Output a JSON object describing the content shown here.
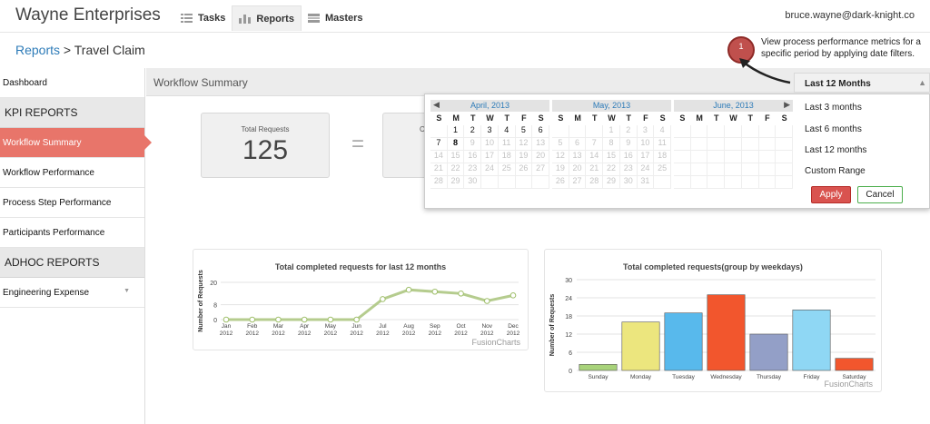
{
  "app": {
    "title": "Wayne Enterprises",
    "user": "bruce.wayne@dark-knight.co"
  },
  "nav": [
    {
      "label": "Tasks",
      "icon": "tasks-icon"
    },
    {
      "label": "Reports",
      "icon": "reports-icon",
      "active": true
    },
    {
      "label": "Masters",
      "icon": "masters-icon"
    }
  ],
  "breadcrumb": {
    "parent": "Reports",
    "separator": ">",
    "current": "Travel Claim"
  },
  "sidebar": {
    "dashboard": "Dashboard",
    "kpi_header": "KPI REPORTS",
    "kpi_items": [
      "Workflow Summary",
      "Workflow Performance",
      "Process Step Performance",
      "Participants Performance"
    ],
    "adhoc_header": "ADHOC REPORTS",
    "adhoc_items": [
      "Engineering Expense"
    ]
  },
  "main": {
    "section_title": "Workflow Summary",
    "total_label": "Total Requests",
    "total_value": "125",
    "equals": "=",
    "second_card_label": "C"
  },
  "callout": {
    "number": "1",
    "text": "View process performance metrics for a specific period by applying date filters."
  },
  "date_filter": {
    "selected": "Last 12 Months",
    "options": [
      "Last 3 months",
      "Last 6 months",
      "Last 12 months",
      "Custom Range"
    ],
    "apply": "Apply",
    "cancel": "Cancel",
    "weekdays": [
      "S",
      "M",
      "T",
      "W",
      "T",
      "F",
      "S"
    ],
    "calendars": [
      {
        "title": "April, 2013",
        "prev": "◀",
        "rows": [
          [
            "",
            "1",
            "2",
            "3",
            "4",
            "5",
            "6"
          ],
          [
            "7",
            "8",
            "9",
            "10",
            "11",
            "12",
            "13"
          ],
          [
            "14",
            "15",
            "16",
            "17",
            "18",
            "19",
            "20"
          ],
          [
            "21",
            "22",
            "23",
            "24",
            "25",
            "26",
            "27"
          ],
          [
            "28",
            "29",
            "30",
            "",
            "",
            "",
            ""
          ]
        ],
        "enabled": [
          "1",
          "2",
          "3",
          "4",
          "5",
          "6",
          "7",
          "8"
        ],
        "bold": [
          "8"
        ]
      },
      {
        "title": "May, 2013",
        "rows": [
          [
            "",
            "",
            "",
            "1",
            "2",
            "3",
            "4"
          ],
          [
            "5",
            "6",
            "7",
            "8",
            "9",
            "10",
            "11"
          ],
          [
            "12",
            "13",
            "14",
            "15",
            "16",
            "17",
            "18"
          ],
          [
            "19",
            "20",
            "21",
            "22",
            "23",
            "24",
            "25"
          ],
          [
            "26",
            "27",
            "28",
            "29",
            "30",
            "31",
            ""
          ]
        ],
        "enabled": [],
        "bold": []
      },
      {
        "title": "June, 2013",
        "next": "▶",
        "rows": [
          [
            "",
            "",
            "",
            "",
            "",
            "",
            ""
          ],
          [
            "",
            "",
            "",
            "",
            "",
            "",
            ""
          ],
          [
            "",
            "",
            "",
            "",
            "",
            "",
            ""
          ],
          [
            "",
            "",
            "",
            "",
            "",
            "",
            ""
          ],
          [
            "",
            "",
            "",
            "",
            "",
            "",
            ""
          ]
        ],
        "enabled": [],
        "bold": []
      }
    ]
  },
  "chart_data": [
    {
      "type": "line",
      "title": "Total completed requests for last 12 months",
      "ylabel": "Number of Requests",
      "xlabel": "",
      "categories": [
        "Jan\n2012",
        "Feb\n2012",
        "Mar\n2012",
        "Apr\n2012",
        "May\n2012",
        "Jun\n2012",
        "Jul\n2012",
        "Aug\n2012",
        "Sep\n2012",
        "Oct\n2012",
        "Nov\n2012",
        "Dec\n2012"
      ],
      "values": [
        0,
        0,
        0,
        0,
        0,
        0,
        11,
        16,
        15,
        14,
        10,
        13
      ],
      "yticks": [
        "0",
        "8",
        "20"
      ],
      "ylim": [
        0,
        20
      ],
      "color": "#b5cc8e",
      "credit": "FusionCharts"
    },
    {
      "type": "bar",
      "title": "Total completed requests(group by weekdays)",
      "ylabel": "Number of Requests",
      "xlabel": "",
      "categories": [
        "Sunday",
        "Monday",
        "Tuesday",
        "Wednesday",
        "Thursday",
        "Friday",
        "Saturday"
      ],
      "values": [
        2,
        16,
        19,
        25,
        12,
        20,
        4
      ],
      "yticks": [
        "0",
        "6",
        "12",
        "18",
        "24",
        "30"
      ],
      "ylim": [
        0,
        30
      ],
      "colors": [
        "#a8d37a",
        "#ece67e",
        "#58b9ec",
        "#f2562d",
        "#939fc7",
        "#8fd7f4",
        "#f2562d"
      ],
      "credit": "FusionCharts"
    }
  ]
}
